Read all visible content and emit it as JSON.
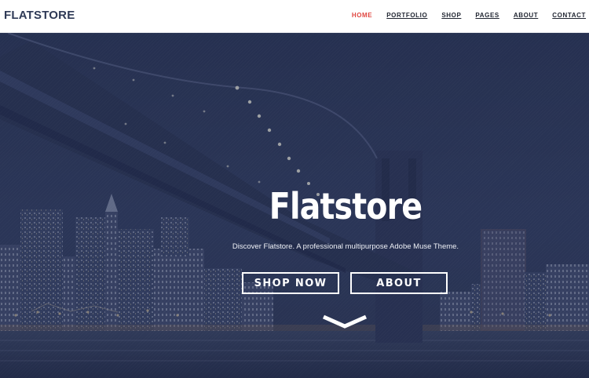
{
  "header": {
    "logo": "FLATSTORE",
    "nav": [
      {
        "label": "HOME",
        "active": true
      },
      {
        "label": "PORTFOLIO",
        "active": false
      },
      {
        "label": "SHOP",
        "active": false
      },
      {
        "label": "PAGES",
        "active": false
      },
      {
        "label": "ABOUT",
        "active": false
      },
      {
        "label": "CONTACT",
        "active": false
      }
    ]
  },
  "hero": {
    "title": "Flatstore",
    "subtitle": "Discover Flatstore. A professional multipurpose Adobe Muse Theme.",
    "buttons": {
      "shop_now": "SHOP NOW",
      "about": "ABOUT"
    },
    "scroll_icon": "chevron-down-icon",
    "background_image": "night city skyline with suspension bridge over river"
  },
  "colors": {
    "accent": "#e0453f",
    "logo": "#2f3a56",
    "overlay": "#263052"
  }
}
